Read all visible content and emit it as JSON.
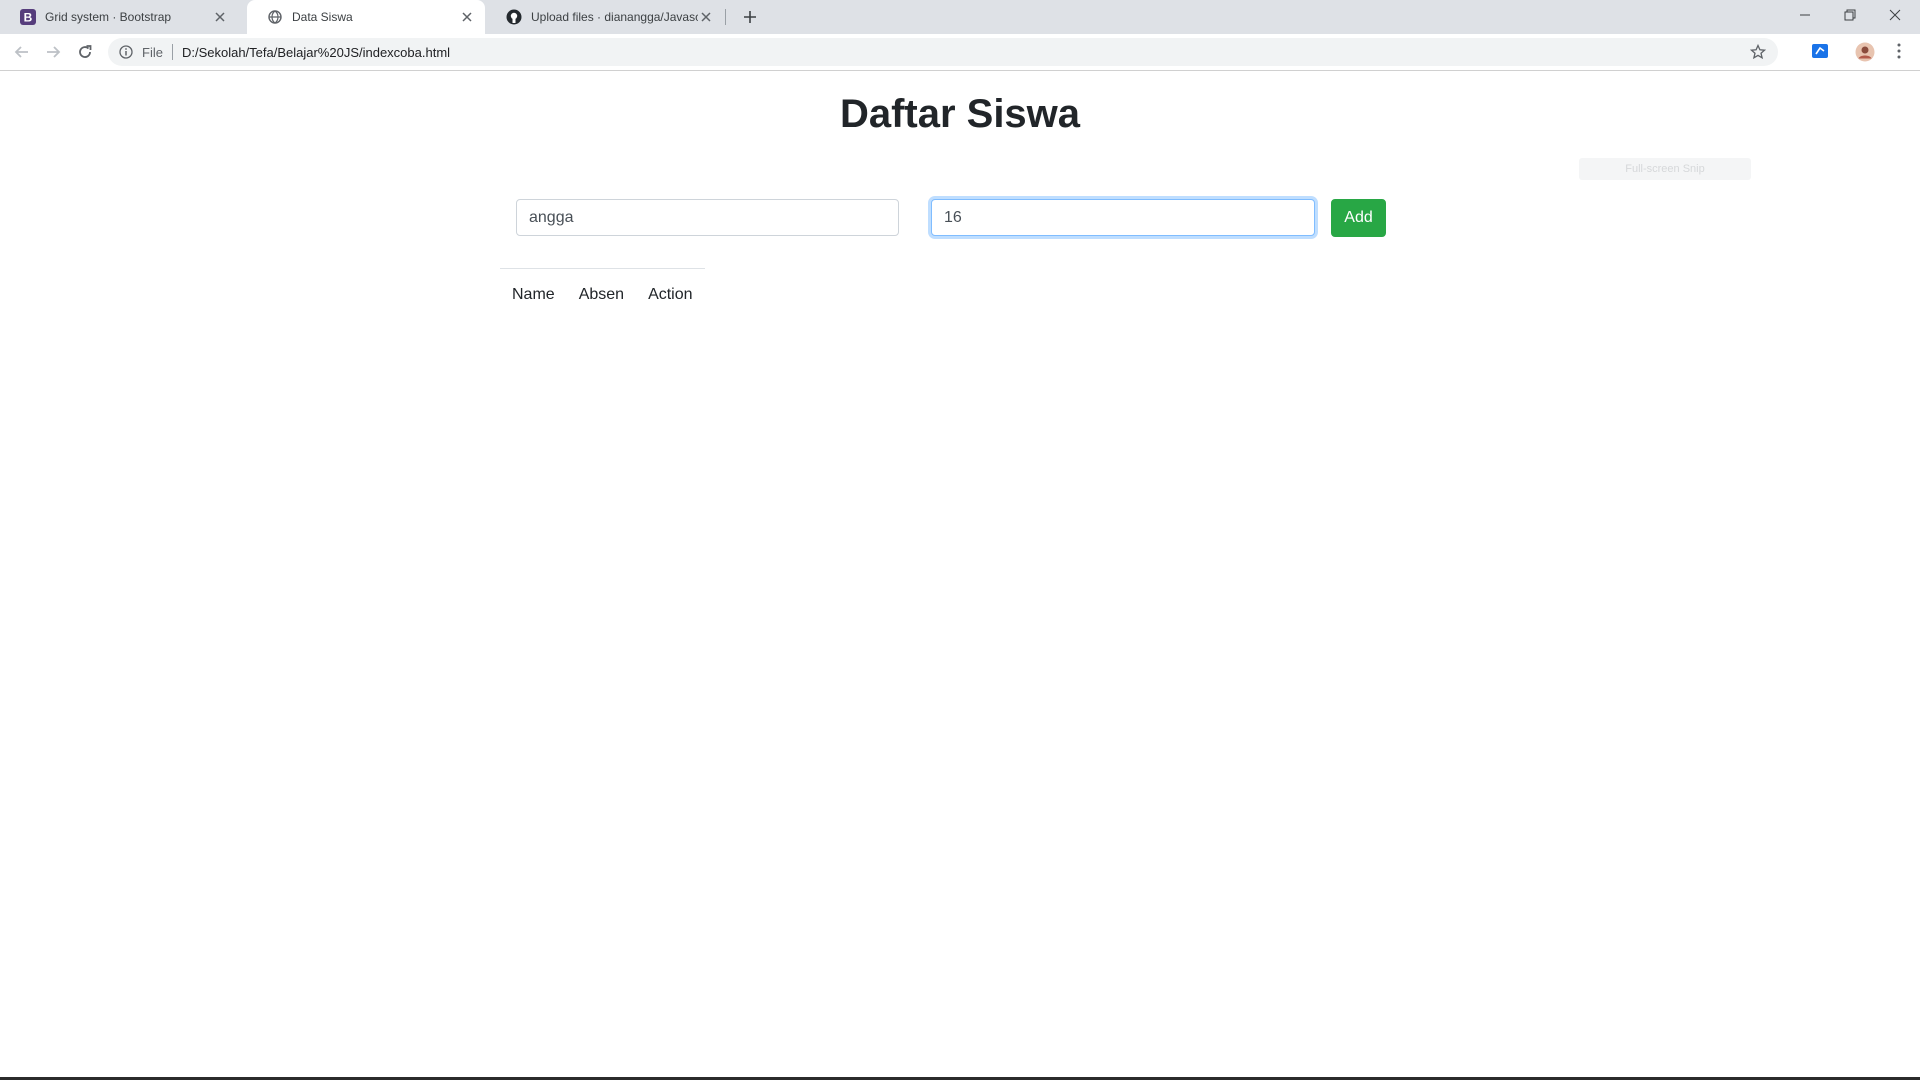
{
  "browser": {
    "tabs": [
      {
        "title": "Grid system · Bootstrap",
        "favicon": "bootstrap-icon",
        "active": false
      },
      {
        "title": "Data Siswa",
        "favicon": "globe-icon",
        "active": true
      },
      {
        "title": "Upload files · dianangga/Javascrip",
        "favicon": "github-icon",
        "active": false
      }
    ],
    "omnibox": {
      "scheme_label": "File",
      "url": "D:/Sekolah/Tefa/Belajar%20JS/indexcoba.html"
    }
  },
  "page": {
    "title": "Daftar Siswa",
    "name_input": {
      "value": "angga"
    },
    "absen_input": {
      "value": "16"
    },
    "add_button": {
      "label": "Add",
      "color": "#28a745"
    },
    "table": {
      "headers": [
        "Name",
        "Absen",
        "Action"
      ]
    }
  },
  "overlay": {
    "snip_label": "Full-screen Snip"
  },
  "colors": {
    "tabstrip": "#dee1e6",
    "focus_border": "#80bdff",
    "success": "#28a745"
  }
}
